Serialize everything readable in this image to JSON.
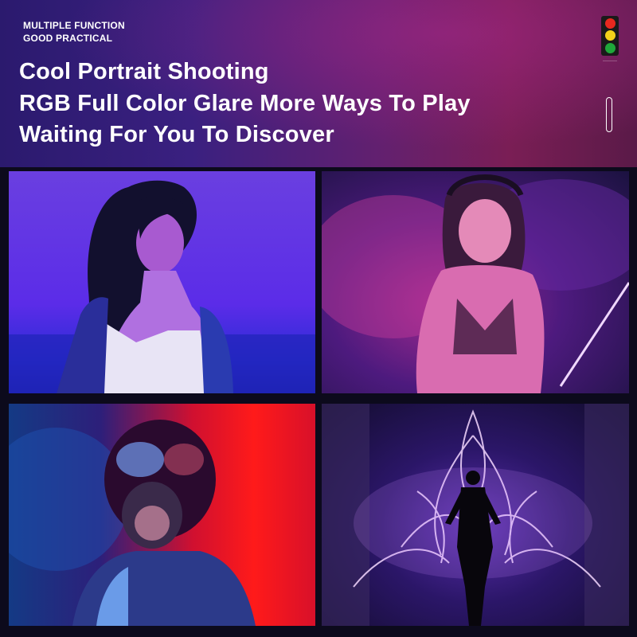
{
  "banner": {
    "tag_line_1": "MULTIPLE FUNCTION",
    "tag_line_2": "GOOD PRACTICAL",
    "headline_1": "Cool Portrait Shooting",
    "headline_2": "RGB Full Color Glare More Ways To Play",
    "headline_3": "Waiting For You To Discover"
  },
  "indicator": {
    "icon": "traffic-light-icon",
    "colors": [
      "#e8281f",
      "#f2d21a",
      "#1fa83a"
    ]
  },
  "scroll_icon": "scroll-indicator-icon",
  "photos": [
    {
      "icon": "portrait-blue-purple-woman"
    },
    {
      "icon": "portrait-pink-smoke-dj"
    },
    {
      "icon": "portrait-gas-mask-red-blue"
    },
    {
      "icon": "light-painting-silhouette"
    }
  ],
  "colors": {
    "accent_purple": "#5b2ce8",
    "accent_magenta": "#a42a8e",
    "accent_red": "#ff1a1a"
  }
}
